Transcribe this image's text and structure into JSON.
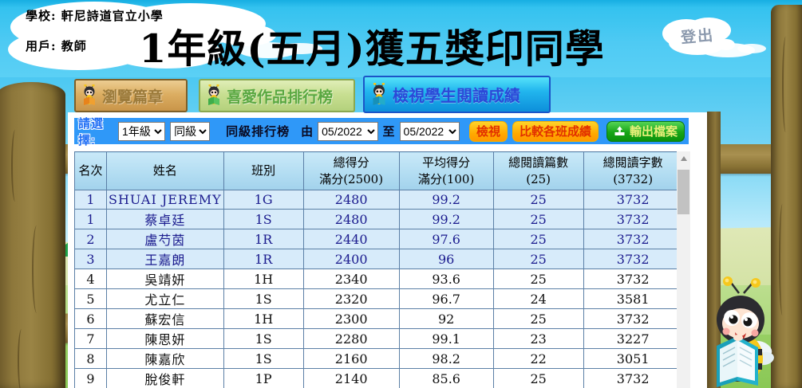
{
  "header": {
    "school_label": "學校: 軒尼詩道官立小學",
    "user_label": "用戶: 教師",
    "title": "1年級(五月)獲五獎印同學",
    "logout_label": "登出"
  },
  "tabs": [
    {
      "label": "瀏覽篇章",
      "active": false
    },
    {
      "label": "喜愛作品排行榜",
      "active": false
    },
    {
      "label": "檢視學生閱讀成績",
      "active": true
    }
  ],
  "filter": {
    "prompt": "請選擇:",
    "grade_selected": "1年級",
    "scope_selected": "同級",
    "ranking_label": "同級排行榜",
    "from_label": "由",
    "from_selected": "05/2022",
    "to_label": "至",
    "to_selected": "05/2022",
    "view_button": "檢視",
    "compare_button": "比較各班成績",
    "export_button": "輸出檔案"
  },
  "table": {
    "columns": [
      {
        "l1": "名次",
        "l2": ""
      },
      {
        "l1": "姓名",
        "l2": ""
      },
      {
        "l1": "班別",
        "l2": ""
      },
      {
        "l1": "總得分",
        "l2": "滿分(2500)"
      },
      {
        "l1": "平均得分",
        "l2": "滿分(100)"
      },
      {
        "l1": "總閱讀篇數",
        "l2": "(25)"
      },
      {
        "l1": "總閱讀字數",
        "l2": "(3732)"
      }
    ],
    "rows": [
      {
        "rank": "1",
        "name": "SHUAI JEREMY",
        "class": "1G",
        "total": "2480",
        "avg": "99.2",
        "articles": "25",
        "words": "3732",
        "highlight": true
      },
      {
        "rank": "1",
        "name": "蔡卓廷",
        "class": "1S",
        "total": "2480",
        "avg": "99.2",
        "articles": "25",
        "words": "3732",
        "highlight": true
      },
      {
        "rank": "2",
        "name": "盧芍茵",
        "class": "1R",
        "total": "2440",
        "avg": "97.6",
        "articles": "25",
        "words": "3732",
        "highlight": true
      },
      {
        "rank": "3",
        "name": "王嘉朗",
        "class": "1R",
        "total": "2400",
        "avg": "96",
        "articles": "25",
        "words": "3732",
        "highlight": true
      },
      {
        "rank": "4",
        "name": "吳靖妍",
        "class": "1H",
        "total": "2340",
        "avg": "93.6",
        "articles": "25",
        "words": "3732",
        "highlight": false
      },
      {
        "rank": "5",
        "name": "尤立仁",
        "class": "1S",
        "total": "2320",
        "avg": "96.7",
        "articles": "24",
        "words": "3581",
        "highlight": false
      },
      {
        "rank": "6",
        "name": "蘇宏信",
        "class": "1H",
        "total": "2300",
        "avg": "92",
        "articles": "25",
        "words": "3732",
        "highlight": false
      },
      {
        "rank": "7",
        "name": "陳思妍",
        "class": "1S",
        "total": "2280",
        "avg": "99.1",
        "articles": "23",
        "words": "3227",
        "highlight": false
      },
      {
        "rank": "8",
        "name": "陳嘉欣",
        "class": "1S",
        "total": "2160",
        "avg": "98.2",
        "articles": "22",
        "words": "3051",
        "highlight": false
      },
      {
        "rank": "9",
        "name": "脫俊軒",
        "class": "1P",
        "total": "2140",
        "avg": "85.6",
        "articles": "25",
        "words": "3732",
        "highlight": false
      }
    ]
  },
  "icons": {
    "logout_cloud": "cloud-shape",
    "tab_bee": "bee-reading-icon",
    "export": "export-tray-icon",
    "scroll_up": "scroll-up-arrow"
  },
  "colors": {
    "filter_bar": "#2f98f8",
    "header_sky": "#45c6f1",
    "active_tab": "#1fb4ee",
    "highlight_row_bg": "#d7ebfa",
    "highlight_row_text": "#1b1b8e",
    "table_border": "#5b7fa6",
    "view_button_bg": "#ffaa00",
    "view_button_text": "#e23000",
    "export_button_bg": "#17a517",
    "wood": "#8d773b"
  }
}
